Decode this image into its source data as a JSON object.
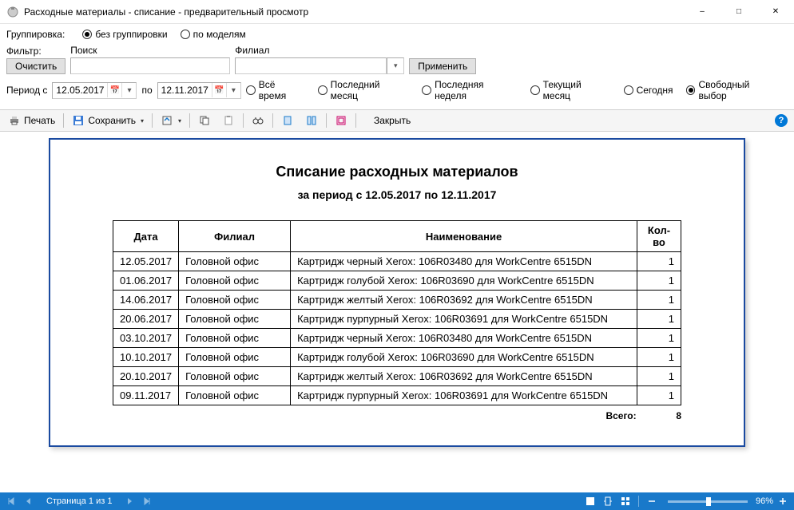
{
  "window": {
    "title": "Расходные материалы - списание - предварительный просмотр"
  },
  "grouping": {
    "label": "Группировка:",
    "opt_none": "без группировки",
    "opt_model": "по моделям",
    "selected": "none"
  },
  "filter": {
    "filter_label": "Фильтр:",
    "search_label": "Поиск",
    "branch_label": "Филиал",
    "clear_btn": "Очистить",
    "apply_btn": "Применить",
    "search_value": "",
    "branch_value": ""
  },
  "period": {
    "label_from": "Период с",
    "label_to": "по",
    "date_from": "12.05.2017",
    "date_to": "12.11.2017",
    "opt_all": "Всё время",
    "opt_last_month": "Последний месяц",
    "opt_last_week": "Последняя неделя",
    "opt_cur_month": "Текущий месяц",
    "opt_today": "Сегодня",
    "opt_free": "Свободный выбор",
    "selected": "free"
  },
  "toolbar": {
    "print": "Печать",
    "save": "Сохранить",
    "close": "Закрыть"
  },
  "report": {
    "title": "Списание расходных материалов",
    "subtitle": "за период с 12.05.2017 по 12.11.2017",
    "columns": {
      "date": "Дата",
      "branch": "Филиал",
      "name": "Наименование",
      "qty": "Кол-во"
    },
    "rows": [
      {
        "date": "12.05.2017",
        "branch": "Головной офис",
        "name": "Картридж черный Xerox: 106R03480 для WorkCentre 6515DN",
        "qty": "1"
      },
      {
        "date": "01.06.2017",
        "branch": "Головной офис",
        "name": "Картридж голубой Xerox: 106R03690 для WorkCentre 6515DN",
        "qty": "1"
      },
      {
        "date": "14.06.2017",
        "branch": "Головной офис",
        "name": "Картридж желтый Xerox: 106R03692 для WorkCentre 6515DN",
        "qty": "1"
      },
      {
        "date": "20.06.2017",
        "branch": "Головной офис",
        "name": "Картридж пурпурный Xerox: 106R03691 для WorkCentre 6515DN",
        "qty": "1"
      },
      {
        "date": "03.10.2017",
        "branch": "Головной офис",
        "name": "Картридж черный Xerox: 106R03480 для WorkCentre 6515DN",
        "qty": "1"
      },
      {
        "date": "10.10.2017",
        "branch": "Головной офис",
        "name": "Картридж голубой Xerox: 106R03690 для WorkCentre 6515DN",
        "qty": "1"
      },
      {
        "date": "20.10.2017",
        "branch": "Головной офис",
        "name": "Картридж желтый Xerox: 106R03692 для WorkCentre 6515DN",
        "qty": "1"
      },
      {
        "date": "09.11.2017",
        "branch": "Головной офис",
        "name": "Картридж пурпурный Xerox: 106R03691 для WorkCentre 6515DN",
        "qty": "1"
      }
    ],
    "total_label": "Всего:",
    "total_value": "8"
  },
  "status": {
    "page_text": "Страница 1 из 1",
    "zoom": "96%"
  }
}
